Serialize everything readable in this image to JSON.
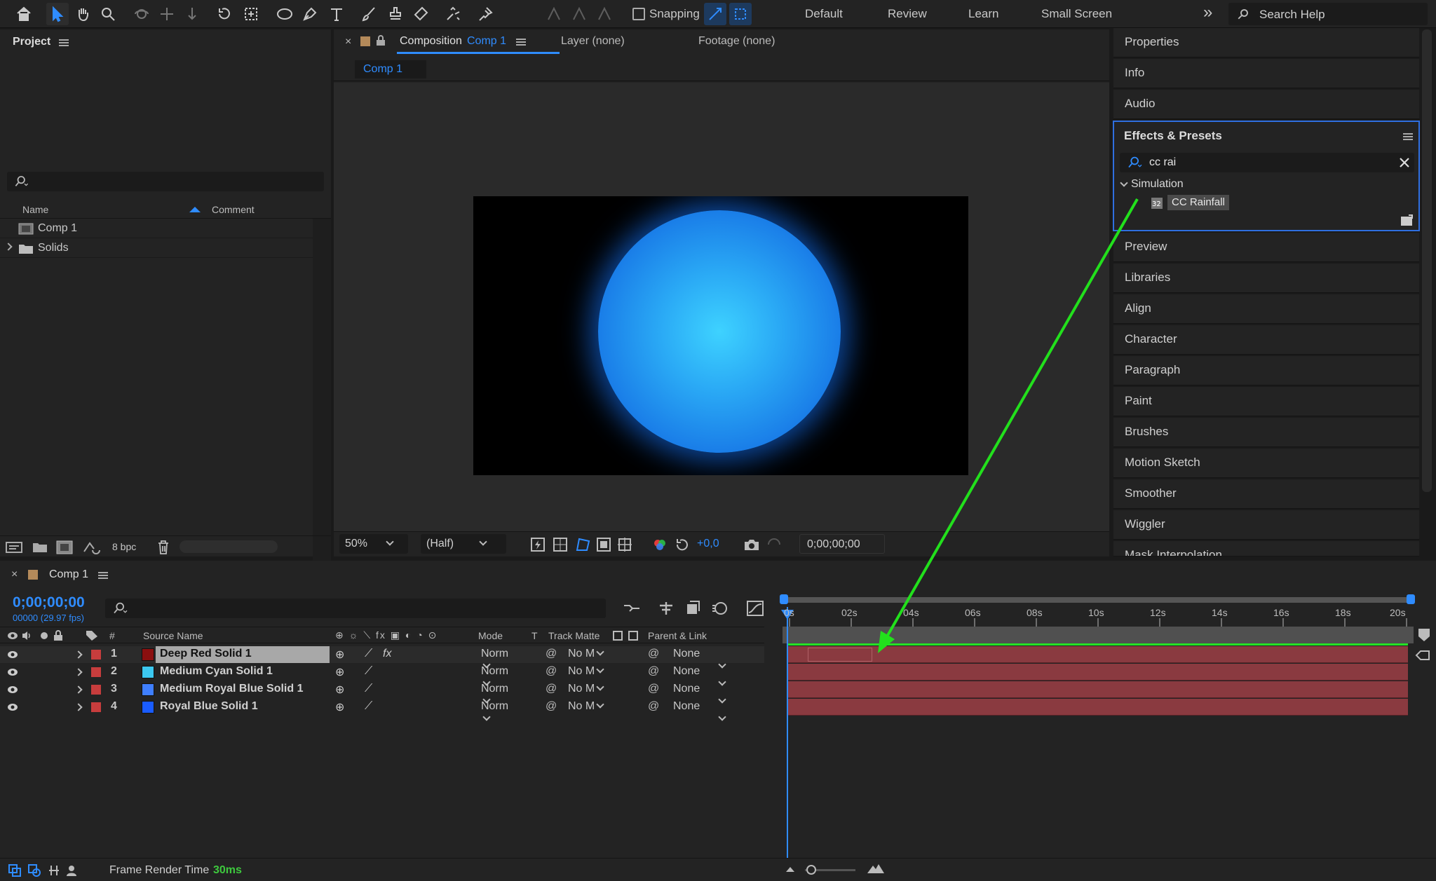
{
  "toolbar": {
    "snapping": "Snapping",
    "workspaces": [
      "Default",
      "Review",
      "Learn",
      "Small Screen"
    ],
    "more": "»",
    "search_help": "Search Help"
  },
  "project": {
    "title": "Project",
    "col_name": "Name",
    "col_comment": "Comment",
    "items": [
      {
        "name": "Comp 1",
        "type": "composition"
      },
      {
        "name": "Solids",
        "type": "folder"
      }
    ],
    "bpc": "8 bpc"
  },
  "comp_viewer": {
    "tab_close": "×",
    "tab_label": "Composition",
    "tab_comp": "Comp 1",
    "layer_tab": "Layer (none)",
    "footage_tab": "Footage (none)",
    "subtab": "Comp 1",
    "zoom": "50%",
    "resolution": "(Half)",
    "exposure": "+0,0",
    "timecode": "0;00;00;00"
  },
  "right_panels": {
    "top": [
      "Properties",
      "Info",
      "Audio"
    ],
    "effects": {
      "title": "Effects & Presets",
      "search_value": "cc rai",
      "category": "Simulation",
      "effect": "CC Rainfall"
    },
    "bottom": [
      "Preview",
      "Libraries",
      "Align",
      "Character",
      "Paragraph",
      "Paint",
      "Brushes",
      "Motion Sketch",
      "Smoother",
      "Wiggler",
      "Mask Interpolation"
    ]
  },
  "timeline": {
    "close": "×",
    "title": "Comp 1",
    "timecode": "0;00;00;00",
    "frames": "00000 (29.97 fps)",
    "ruler": [
      "0s",
      "02s",
      "04s",
      "06s",
      "08s",
      "10s",
      "12s",
      "14s",
      "16s",
      "18s",
      "20s"
    ],
    "headers": {
      "num": "#",
      "source": "Source Name",
      "mode": "Mode",
      "t": "T",
      "track": "Track Matte",
      "parent": "Parent & Link"
    },
    "layers": [
      {
        "num": "1",
        "name": "Deep Red Solid 1",
        "color": "#8b0f0f",
        "mode": "Norm",
        "track": "No M",
        "parent": "None",
        "selected": true
      },
      {
        "num": "2",
        "name": "Medium Cyan Solid 1",
        "color": "#3cc8f0",
        "mode": "Norm",
        "track": "No M",
        "parent": "None",
        "selected": false
      },
      {
        "num": "3",
        "name": "Medium Royal Blue Solid 1",
        "color": "#3f7fff",
        "mode": "Norm",
        "track": "No M",
        "parent": "None",
        "selected": false
      },
      {
        "num": "4",
        "name": "Royal Blue Solid 1",
        "color": "#1a5cff",
        "mode": "Norm",
        "track": "No M",
        "parent": "None",
        "selected": false
      }
    ],
    "label_color": "#c73d3d",
    "frame_render_label": "Frame Render Time",
    "frame_render_value": "30ms"
  },
  "colors": {
    "accent": "#2f8cff",
    "annotation_arrow": "#22e01c",
    "green_text": "#3ec93e"
  }
}
